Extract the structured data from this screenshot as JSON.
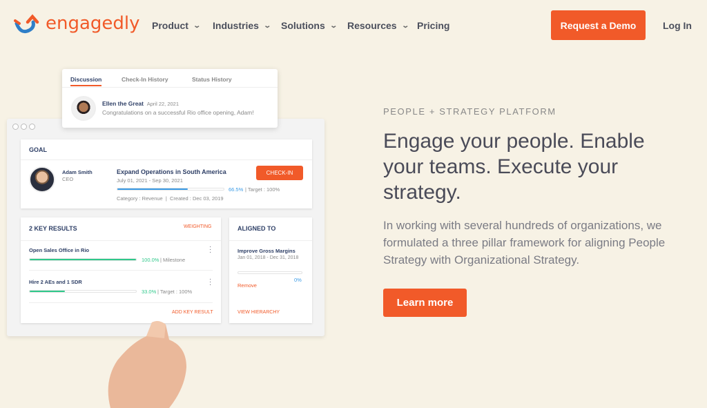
{
  "brand": {
    "name": "engagedly",
    "colors": {
      "orange": "#f15a29",
      "blue": "#2f7fc8",
      "bg": "#f7f2e5"
    }
  },
  "nav": {
    "items": [
      {
        "label": "Product",
        "dropdown": true
      },
      {
        "label": "Industries",
        "dropdown": true
      },
      {
        "label": "Solutions",
        "dropdown": true
      },
      {
        "label": "Resources",
        "dropdown": true
      },
      {
        "label": "Pricing",
        "dropdown": false
      }
    ],
    "demo": "Request a Demo",
    "login": "Log In"
  },
  "popover": {
    "tabs": [
      "Discussion",
      "Check-In History",
      "Status History"
    ],
    "active_tab": "Discussion",
    "author": "Ellen the Great",
    "date": "April 22, 2021",
    "message": "Congratulations on a successful Rio office opening, Adam!"
  },
  "goal": {
    "header": "GOAL",
    "owner": "Adam Smith",
    "role": "CEO",
    "title": "Expand Operations in South America",
    "dates": "July 01, 2021 - Sep 30, 2021",
    "progress": 66.5,
    "progress_label": "66.5%",
    "target": "Target : 100%",
    "category": "Category : Revenue",
    "created": "Created : Dec 03, 2019",
    "checkin": "CHECK-IN"
  },
  "key_results": {
    "header": "2 KEY RESULTS",
    "weighting": "WEIGHTING",
    "items": [
      {
        "title": "Open Sales Office in Rio",
        "progress": 100,
        "progress_label": "100.0%",
        "meta": "Milestone"
      },
      {
        "title": "Hire 2 AEs and 1 SDR",
        "progress": 33,
        "progress_label": "33.0%",
        "meta": "Target : 100%"
      }
    ],
    "add": "ADD KEY RESULT"
  },
  "aligned": {
    "header": "ALIGNED TO",
    "title": "Improve Gross Margins",
    "dates": "Jan 01, 2018 - Dec 31, 2018",
    "progress": 0,
    "progress_label": "0%",
    "remove": "Remove",
    "view": "VIEW HIERARCHY"
  },
  "hero": {
    "eyebrow": "PEOPLE + STRATEGY PLATFORM",
    "headline": "Engage your people. Enable your teams. Execute your strategy.",
    "body": "In working with several hundreds of organizations, we formulated a three pillar framework for aligning People Strategy with Organizational Strategy.",
    "cta": "Learn more"
  }
}
